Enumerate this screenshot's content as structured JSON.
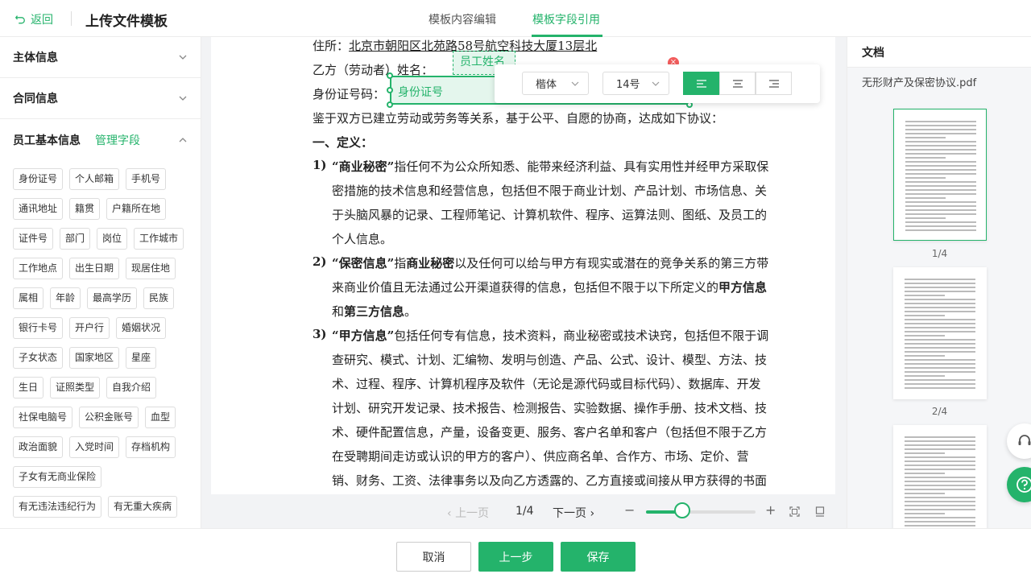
{
  "header": {
    "back_label": "返回",
    "title": "上传文件模板",
    "tabs": [
      {
        "label": "模板内容编辑",
        "active": false
      },
      {
        "label": "模板字段引用",
        "active": true
      }
    ]
  },
  "left_panel": {
    "sections": [
      {
        "label": "主体信息",
        "expanded": false
      },
      {
        "label": "合同信息",
        "expanded": false
      },
      {
        "label": "员工基本信息",
        "expanded": true,
        "manage_label": "管理字段"
      }
    ],
    "tags": [
      "身份证号",
      "个人邮箱",
      "手机号",
      "通讯地址",
      "籍贯",
      "户籍所在地",
      "证件号",
      "部门",
      "岗位",
      "工作城市",
      "工作地点",
      "出生日期",
      "现居住地",
      "属相",
      "年龄",
      "最高学历",
      "民族",
      "银行卡号",
      "开户行",
      "婚姻状况",
      "子女状态",
      "国家地区",
      "星座",
      "生日",
      "证照类型",
      "自我介绍",
      "社保电脑号",
      "公积金账号",
      "血型",
      "政治面貌",
      "入党时间",
      "存档机构",
      "子女有无商业保险",
      "有无违法违纪行为",
      "有无重大疾病"
    ]
  },
  "document": {
    "address_label": "住所：",
    "address_value": "北京市朝阳区北苑路58号航空科技大厦13层北",
    "party_b_label": "乙方（劳动者）姓名：",
    "party_b_blank": "_",
    "id_label": "身份证号码：",
    "field_name": "员工姓名",
    "field_id": "身份证号",
    "intro": "鉴于双方已建立劳动或劳务等关系，基于公平、自愿的协商，达成如下协议：",
    "section_title": "一、定义：",
    "items": [
      {
        "num": "1)",
        "term": "“商业秘密”",
        "lines": [
          "指任何不为公众所知悉、能带来经济利益、具有实用性并经甲方采取保",
          "密措施的技术信息和经营信息，包括但不限于商业计划、产品计划、市场信息、关",
          "于头脑风暴的记录、工程师笔记、计算机软件、程序、运算法则、图纸、及员工的",
          "个人信息。"
        ]
      },
      {
        "num": "2)",
        "term": "“保密信息”",
        "lines": [
          "指",
          "商业秘密",
          "以及任何可以给与甲方有现实或潜在的竞争关系的第三方带",
          "来商业价值且无法通过公开渠道获得的信息，包括但不限于以下所定义的",
          "甲方信息",
          "和",
          "第三方信息",
          "。"
        ]
      },
      {
        "num": "3)",
        "term": "“甲方信息”",
        "lines": [
          "包括任何专有信息，技术资料，商业秘密或技术诀窍，包括但不限于调",
          "查研究、模式、计划、汇编物、发明与创造、产品、公式、设计、模型、方法、技",
          "术、过程、程序、计算机程序及软件（无论是源代码或目标代码）、数据库、开发",
          "计划、研究开发记录、技术报告、检测报告、实验数据、操作手册、技术文档、技",
          "术、硬件配置信息，产量，设备变更、服务、客户名单和客户（包括但不限于乙方",
          "在受聘期间走访或认识的甲方的客户）、供应商名单、合作方、市场、定价、营",
          "销、财务、工资、法律事务以及向乙方透露的、乙方直接或间接从甲方获得的书面"
        ]
      }
    ]
  },
  "toolbar": {
    "font": "楷体",
    "size": "14号",
    "align_active": "left"
  },
  "pager": {
    "prev": "上一页",
    "page": "1/4",
    "next": "下一页",
    "zoom_fraction": 0.33
  },
  "right_panel": {
    "title": "文档",
    "file_name": "无形财产及保密协议.pdf",
    "pages": [
      "1/4",
      "2/4"
    ]
  },
  "footer": {
    "cancel": "取消",
    "prev_step": "上一步",
    "save": "保存"
  },
  "colors": {
    "accent": "#24b36b",
    "close": "#f25c5c"
  }
}
